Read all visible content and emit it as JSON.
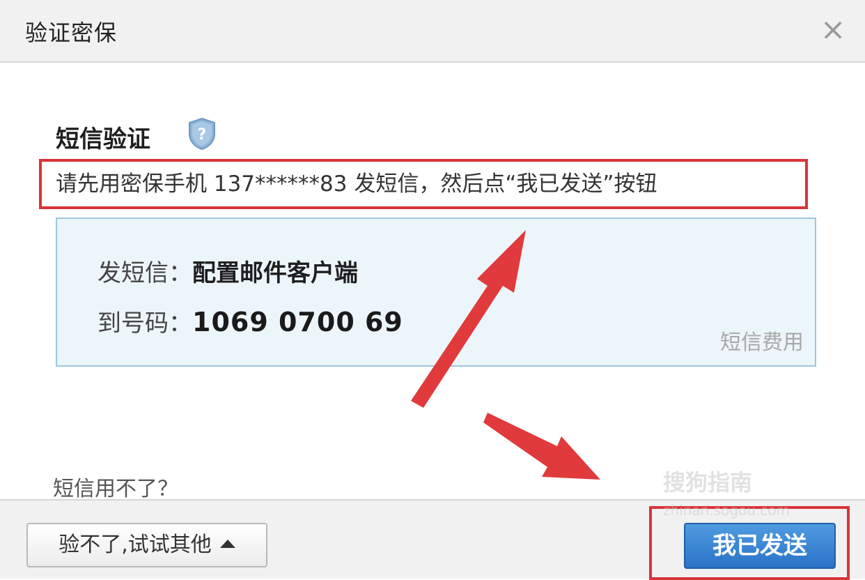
{
  "dialog": {
    "title": "验证密保",
    "close_symbol": "×"
  },
  "section": {
    "heading": "短信验证"
  },
  "instruction": {
    "text": "请先用密保手机 137******83 发短信，然后点“我已发送”按钮"
  },
  "sms": {
    "content_label": "发短信：",
    "content_value": "配置邮件客户端",
    "number_label": "到号码：",
    "number_value": "1069 0700 69",
    "fee_link": "短信费用"
  },
  "links": {
    "cant_use": "短信用不了？"
  },
  "footer": {
    "try_other_label": "验不了,试试其他",
    "sent_button_label": "我已发送"
  },
  "watermark": {
    "main": "搜狗指南",
    "sub": "zhinan.sogou.com"
  },
  "colors": {
    "highlight_red": "#d8343a",
    "primary_blue": "#2a73c7",
    "panel_bg": "#ecf5fa"
  },
  "icons": {
    "help": "shield-question-icon",
    "close": "close-icon",
    "caret": "caret-up-icon"
  }
}
